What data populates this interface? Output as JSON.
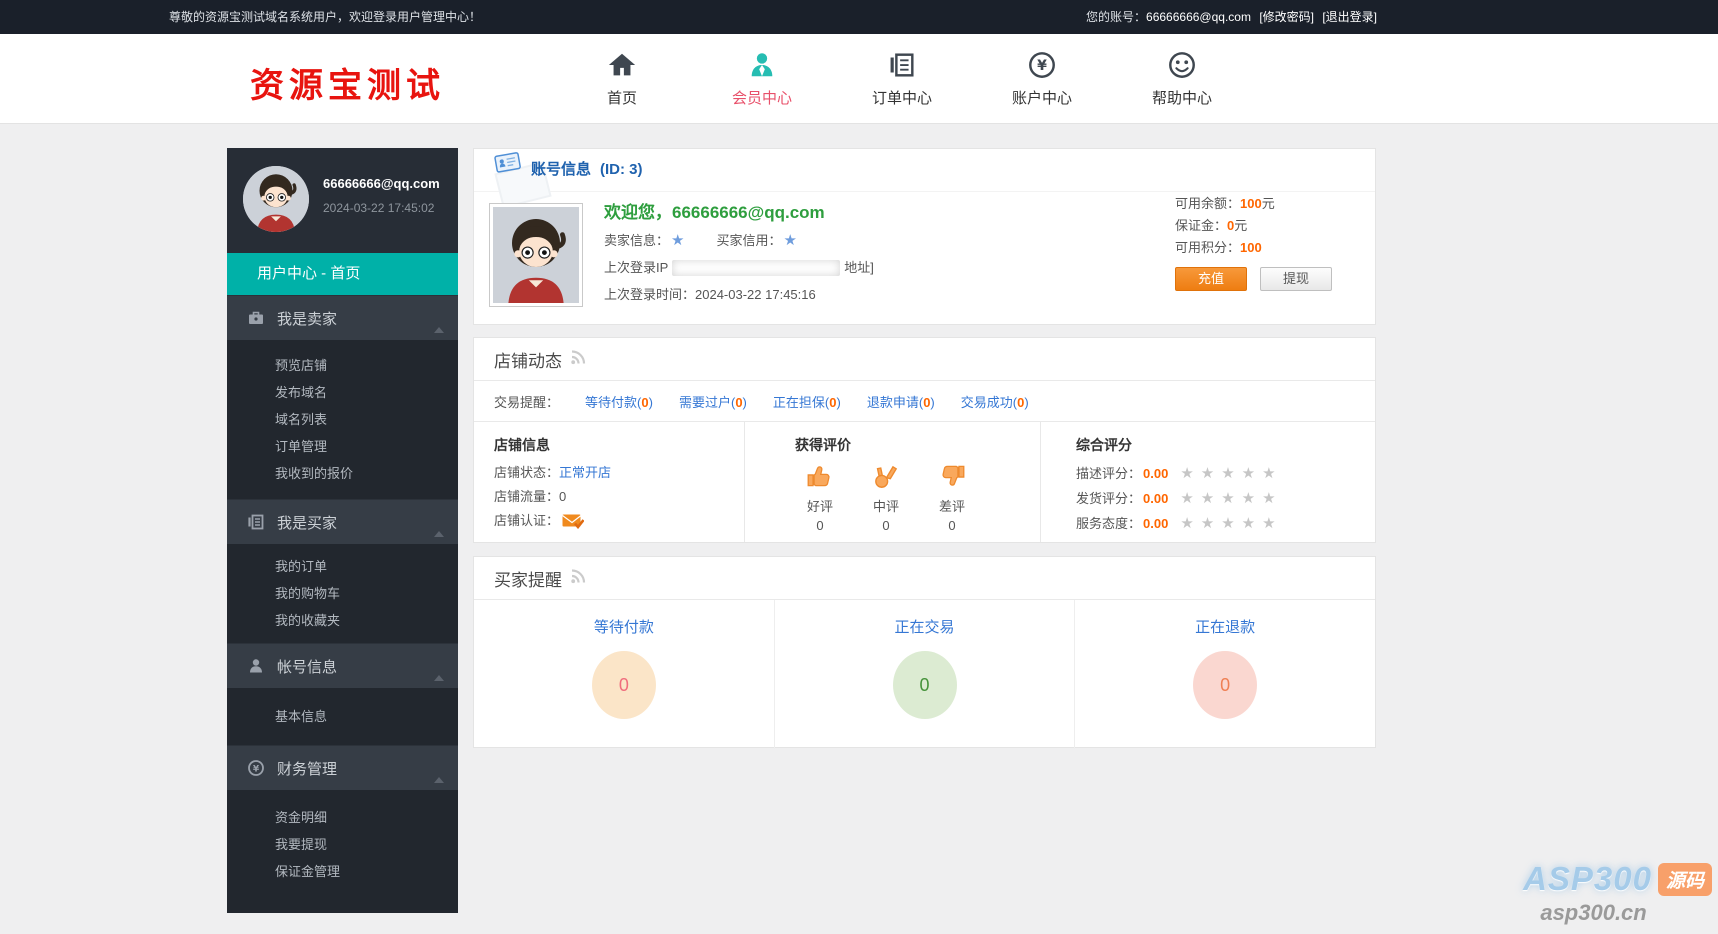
{
  "topbar": {
    "welcome": "尊敬的资源宝测试域名系统用户，欢迎登录用户管理中心！",
    "account_label": "您的账号：",
    "account_email": "66666666@qq.com",
    "change_password": "[修改密码]",
    "logout": "[退出登录]"
  },
  "header": {
    "logo": "资源宝测试",
    "nav": [
      {
        "label": "首页"
      },
      {
        "label": "会员中心"
      },
      {
        "label": "订单中心"
      },
      {
        "label": "账户中心"
      },
      {
        "label": "帮助中心"
      }
    ]
  },
  "sidebar": {
    "email": "66666666@qq.com",
    "login_time": "2024-03-22 17:45:02",
    "current_page": "用户中心 - 首页",
    "sections": [
      {
        "label": "我是卖家",
        "items": [
          "预览店铺",
          "发布域名",
          "域名列表",
          "订单管理",
          "我收到的报价"
        ]
      },
      {
        "label": "我是买家",
        "items": [
          "我的订单",
          "我的购物车",
          "我的收藏夹"
        ]
      },
      {
        "label": "帐号信息",
        "items": [
          "基本信息"
        ]
      },
      {
        "label": "财务管理",
        "items": [
          "资金明细",
          "我要提现",
          "保证金管理"
        ]
      }
    ]
  },
  "account": {
    "panel_title": "账号信息",
    "panel_id": "(ID: 3)",
    "welcome": "欢迎您，66666666@qq.com",
    "seller_info_label": "卖家信息：",
    "buyer_credit_label": "买家信用：",
    "last_ip_label": "上次登录IP",
    "last_ip_suffix": "地址]",
    "last_login_label": "上次登录时间：",
    "last_login_time": "2024-03-22 17:45:16",
    "balance_label": "可用余额：",
    "balance_value": "100",
    "balance_unit": "元",
    "deposit_label": "保证金：",
    "deposit_value": "0",
    "deposit_unit": "元",
    "points_label": "可用积分：",
    "points_value": "100",
    "recharge_button": "充值",
    "withdraw_button": "提现"
  },
  "shop": {
    "panel_title": "店铺动态",
    "reminder_label": "交易提醒：",
    "reminders": [
      {
        "label": "等待付款",
        "count": "0"
      },
      {
        "label": "需要过户",
        "count": "0"
      },
      {
        "label": "正在担保",
        "count": "0"
      },
      {
        "label": "退款申请",
        "count": "0"
      },
      {
        "label": "交易成功",
        "count": "0"
      }
    ],
    "shop_info": {
      "title": "店铺信息",
      "status_label": "店铺状态：",
      "status_value": "正常开店",
      "traffic_label": "店铺流量：",
      "traffic_value": "0",
      "cert_label": "店铺认证："
    },
    "ratings": {
      "title": "获得评价",
      "items": [
        {
          "label": "好评",
          "count": "0"
        },
        {
          "label": "中评",
          "count": "0"
        },
        {
          "label": "差评",
          "count": "0"
        }
      ]
    },
    "scores": {
      "title": "综合评分",
      "items": [
        {
          "label": "描述评分：",
          "value": "0.00"
        },
        {
          "label": "发货评分：",
          "value": "0.00"
        },
        {
          "label": "服务态度：",
          "value": "0.00"
        }
      ]
    }
  },
  "buyer": {
    "panel_title": "买家提醒",
    "items": [
      {
        "label": "等待付款",
        "count": "0",
        "circle_bg": "#fbe5c8",
        "count_color": "#f06d7d"
      },
      {
        "label": "正在交易",
        "count": "0",
        "circle_bg": "#dcebd2",
        "count_color": "#45923a"
      },
      {
        "label": "正在退款",
        "count": "0",
        "circle_bg": "#fad7d0",
        "count_color": "#ef7f53"
      }
    ]
  },
  "watermark": {
    "brand": "ASP300",
    "badge": "源码",
    "domain": "asp300.cn"
  },
  "colors": {
    "topbar_bg": "#1a202a",
    "teal": "#00b1a8",
    "logo_red": "#e8140f",
    "active_nav_text": "#e8506a",
    "active_nav_icon": "#26bdb2",
    "link_blue": "#3577d4",
    "value_orange": "#ff6600",
    "welcome_green": "#2e9e3e",
    "panel_title_blue": "#1f62ae"
  }
}
